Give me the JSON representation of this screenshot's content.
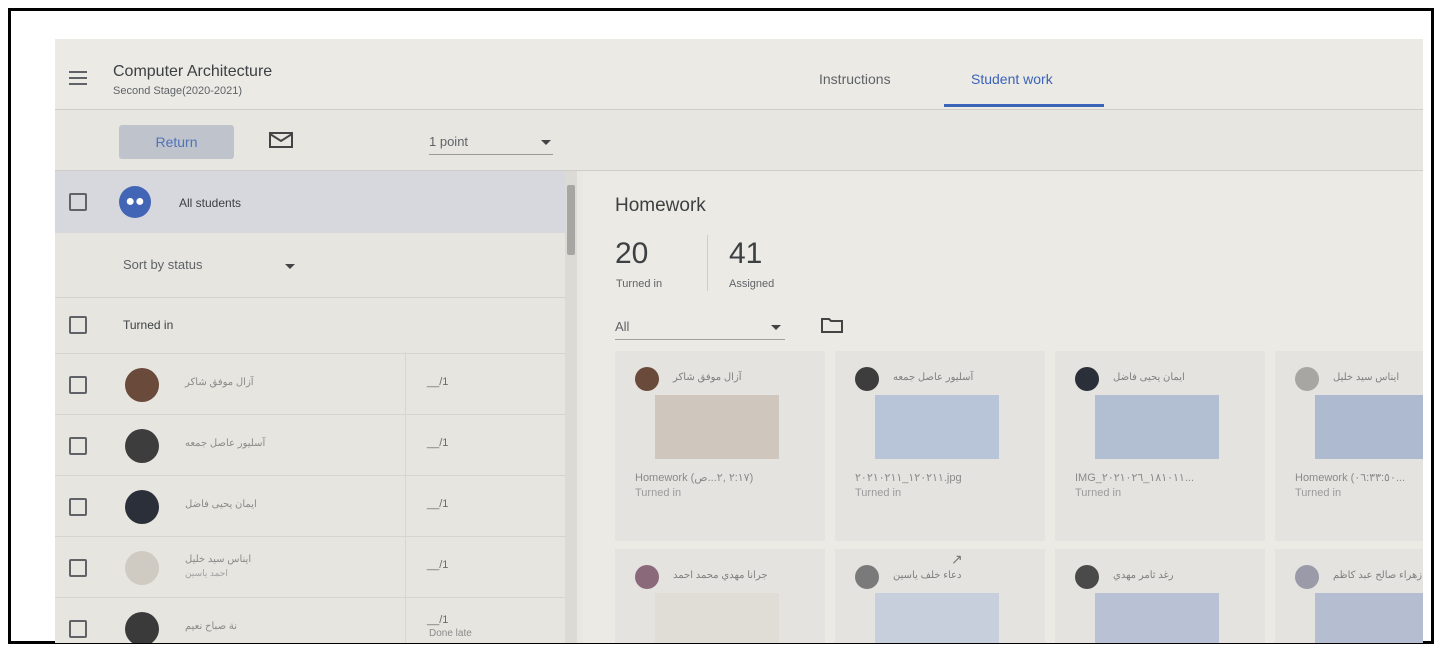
{
  "header": {
    "course_title": "Computer Architecture",
    "course_subtitle": "Second Stage(2020-2021)",
    "tabs": [
      {
        "label": "Instructions"
      },
      {
        "label": "Student work"
      }
    ]
  },
  "toolbar": {
    "return_label": "Return",
    "points_value": "1 point"
  },
  "left": {
    "all_students_label": "All students",
    "sort_label": "Sort by status",
    "section_label": "Turned in",
    "students": [
      {
        "name": "آزال موفق شاكر",
        "grade": "__/1",
        "sub": "",
        "grade_sub": ""
      },
      {
        "name": "آسليور عاصل جمعه",
        "grade": "__/1",
        "sub": "",
        "grade_sub": ""
      },
      {
        "name": "ايمان يحيى فاضل",
        "grade": "__/1",
        "sub": "",
        "grade_sub": ""
      },
      {
        "name": "ايناس سيد خليل",
        "grade": "__/1",
        "sub": "احمد ياسين",
        "grade_sub": ""
      },
      {
        "name": "نة صباح نعيم",
        "grade": "__/1",
        "sub": "",
        "grade_sub": "Done late"
      }
    ]
  },
  "right": {
    "title": "Homework",
    "turned_in_count": "20",
    "turned_in_label": "Turned in",
    "assigned_count": "41",
    "assigned_label": "Assigned",
    "filter_value": "All",
    "cards": [
      {
        "name": "آزال موفق شاكر",
        "file": "Homework (٢:١٧ ,٢...ص)",
        "status": "Turned in"
      },
      {
        "name": "آسليور عاصل جمعه",
        "file": "١٢٠٢١١_٢٠٢١٠٢١١.jpg",
        "status": "Turned in"
      },
      {
        "name": "ايمان يحيى فاضل",
        "file": "IMG_١٨١٠١١_٢٠٢١٠٢٦...",
        "status": "Turned in"
      },
      {
        "name": "ايناس سيد خليل",
        "file": "Homework (٠٦:٣٣:٥٠...",
        "status": "Turned in"
      },
      {
        "name": "جرانا مهدي محمد احمد",
        "file": "",
        "status": ""
      },
      {
        "name": "دعاء خلف ياسين",
        "file": "",
        "status": ""
      },
      {
        "name": "رغد ثامر مهدي",
        "file": "",
        "status": ""
      },
      {
        "name": "زهراء صالح عبد كاظم",
        "file": "",
        "status": ""
      }
    ]
  },
  "colors": {
    "accent": "#3b63b8",
    "group_icon": "#4265b5"
  }
}
